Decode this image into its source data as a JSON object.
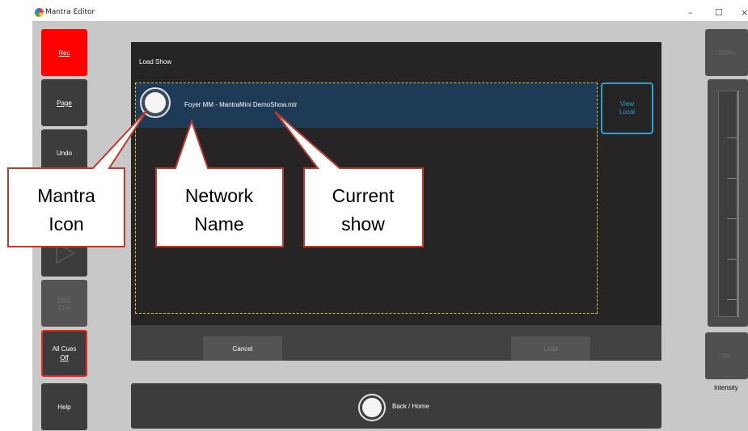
{
  "window": {
    "title": "Mantra Editor",
    "minimize": "–",
    "maximize": "☐",
    "close": "×"
  },
  "sidebar": {
    "rec": "Rec",
    "page": "Page",
    "undo": "Undo",
    "next_cue_1": "Next",
    "next_cue_2": "Cue",
    "all_cues_off_1": "All Cues",
    "all_cues_off_2": "Off",
    "help": "Help"
  },
  "dialog": {
    "title": "Load Show",
    "show_name": "Foyer MM - MantraMini DemoShow.mtr",
    "view_local_1": "View",
    "view_local_2": "Local",
    "cancel": "Cancel",
    "load": "Load"
  },
  "back_home": "Back / Home",
  "right_panel": {
    "top_value": "100%",
    "bottom_value": "0%",
    "intensity_label": "Intensity"
  },
  "callouts": {
    "mantra_icon_1": "Mantra",
    "mantra_icon_2": "Icon",
    "network_name_1": "Network",
    "network_name_2": "Name",
    "current_show_1": "Current",
    "current_show_2": "show"
  },
  "colors": {
    "rec": "#ff0000",
    "accent_blue": "#2f9fd7",
    "callout_border": "#c0392b",
    "selection": "#1d3b57"
  }
}
